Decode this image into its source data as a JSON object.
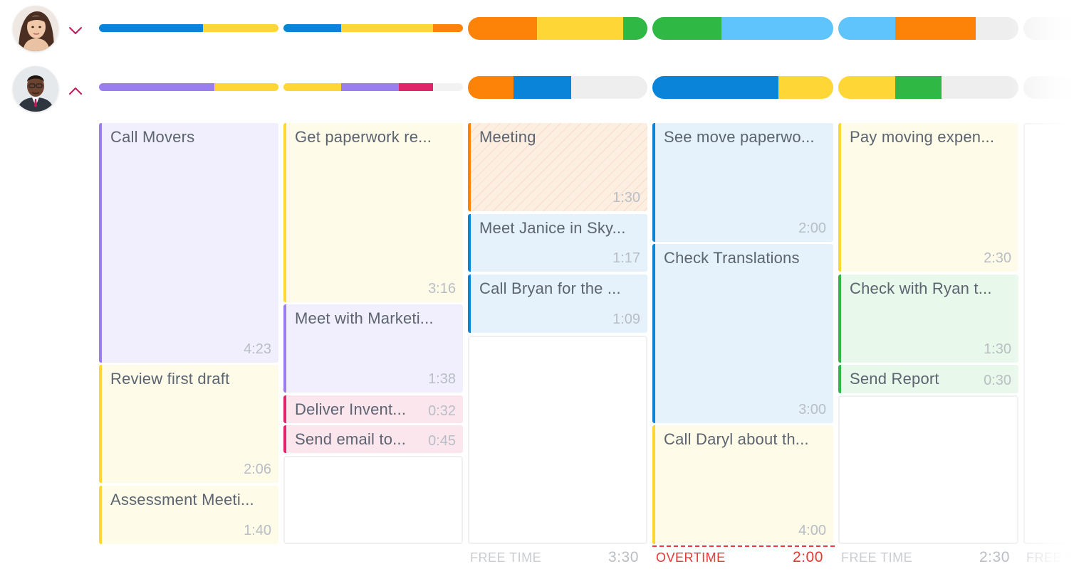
{
  "colors": {
    "blue": "#0a84d8",
    "yellow": "#fed636",
    "orange": "#fd8208",
    "green": "#2fb844",
    "light_blue": "#5ec4fb",
    "purple": "#9a7ef0",
    "pink": "#e0256b",
    "gray": "#eeeeee",
    "card_purple_bg": "#f1effd",
    "card_yellow_bg": "#fefbe9",
    "card_blue_bg": "#e5f2fb",
    "card_green_bg": "#e8f8ea",
    "card_pink_bg": "#fce6ee",
    "overtime_red": "#e53935"
  },
  "users": [
    {
      "name": "user-1",
      "chevron_icon": "chevron-down-icon",
      "expanded": false
    },
    {
      "name": "user-2",
      "chevron_icon": "chevron-up-icon",
      "expanded": true
    }
  ],
  "days": [
    {
      "tasks": [
        {
          "title": "Call Movers",
          "duration": "4:23",
          "color": "purple"
        },
        {
          "title": "Review first draft",
          "duration": "2:06",
          "color": "yellow"
        },
        {
          "title": "Assessment Meeti...",
          "duration": "1:40",
          "color": "yellow"
        }
      ]
    },
    {
      "tasks": [
        {
          "title": "Get paperwork re...",
          "duration": "3:16",
          "color": "yellow"
        },
        {
          "title": "Meet with Marketi...",
          "duration": "1:38",
          "color": "purple"
        },
        {
          "title": "Deliver Invent...",
          "duration": "0:32",
          "color": "pink"
        },
        {
          "title": "Send email to...",
          "duration": "0:45",
          "color": "pink"
        }
      ]
    },
    {
      "tasks": [
        {
          "title": "Meeting",
          "duration": "1:30",
          "color": "orange"
        },
        {
          "title": "Meet Janice in Sky...",
          "duration": "1:17",
          "color": "blue"
        },
        {
          "title": "Call Bryan for the ...",
          "duration": "1:09",
          "color": "blue"
        }
      ],
      "footer": {
        "label": "FREE TIME",
        "value": "3:30"
      }
    },
    {
      "tasks": [
        {
          "title": "See move paperwo...",
          "duration": "2:00",
          "color": "blue"
        },
        {
          "title": "Check Translations",
          "duration": "3:00",
          "color": "blue"
        },
        {
          "title": "Call Daryl about th...",
          "duration": "4:00",
          "color": "yellow"
        }
      ],
      "footer": {
        "label": "OVERTIME",
        "value": "2:00"
      }
    },
    {
      "tasks": [
        {
          "title": "Pay moving expen...",
          "duration": "2:30",
          "color": "yellow"
        },
        {
          "title": "Check with Ryan t...",
          "duration": "1:30",
          "color": "green"
        },
        {
          "title": "Send Report",
          "duration": "0:30",
          "color": "green"
        }
      ],
      "footer": {
        "label": "FREE TIME",
        "value": "2:30"
      }
    },
    {
      "tasks": [],
      "footer": {
        "label": "FREE T",
        "value": ""
      }
    }
  ]
}
